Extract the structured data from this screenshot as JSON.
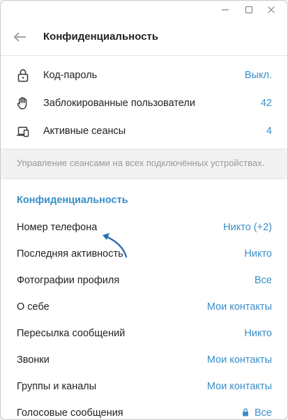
{
  "header": {
    "title": "Конфиденциальность"
  },
  "security": {
    "items": [
      {
        "icon": "lock-icon",
        "label": "Код-пароль",
        "value": "Выкл."
      },
      {
        "icon": "hand-icon",
        "label": "Заблокированные пользователи",
        "value": "42"
      },
      {
        "icon": "devices-icon",
        "label": "Активные сеансы",
        "value": "4"
      }
    ],
    "note": "Управление сеансами на всех подключённых устройствах."
  },
  "privacy": {
    "title": "Конфиденциальность",
    "items": [
      {
        "label": "Номер телефона",
        "value": "Никто (+2)"
      },
      {
        "label": "Последняя активность",
        "value": "Никто"
      },
      {
        "label": "Фотографии профиля",
        "value": "Все"
      },
      {
        "label": "О себе",
        "value": "Мои контакты"
      },
      {
        "label": "Пересылка сообщений",
        "value": "Никто"
      },
      {
        "label": "Звонки",
        "value": "Мои контакты"
      },
      {
        "label": "Группы и каналы",
        "value": "Мои контакты"
      },
      {
        "label": "Голосовые сообщения",
        "value": "Все",
        "locked": true
      }
    ]
  },
  "colors": {
    "accent": "#3a8fc9",
    "annotation_arrow": "#2b6fb3"
  }
}
